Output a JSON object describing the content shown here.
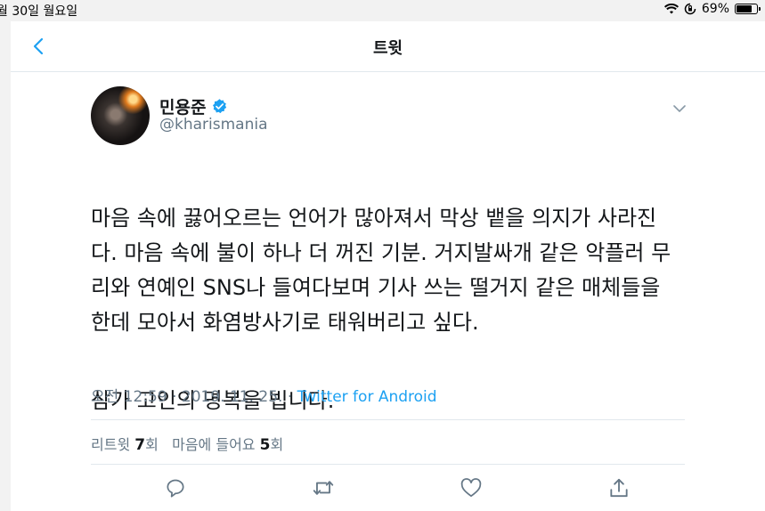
{
  "status_bar": {
    "date": "월 30일 월요일",
    "battery": "69%",
    "battery_level": 0.69
  },
  "navbar": {
    "title": "트윗",
    "back_icon": "chevron-left-icon"
  },
  "author": {
    "display_name": "민용준",
    "handle": "@kharismania",
    "verified": true
  },
  "tweet": {
    "paragraphs": [
      "마음 속에 끓어오르는 언어가 많아져서 막상 뱉을 의지가 사라진\n다. 마음 속에 불이 하나 더 꺼진 기분. 거지발싸개 같은 악플러 무\n리와 연예인 SNS나 들여다보며 기사 쓰는 떨거지 같은 매체들을\n한데 모아서 화염방사기로 태워버리고 싶다.",
      "삼가 고인의 명복을 빕니다."
    ]
  },
  "meta": {
    "time": "오전 12:59",
    "date": "2019. 11. 25.",
    "separator": "·",
    "source": "Twitter for Android"
  },
  "stats": {
    "retweets_label": "리트윗",
    "retweets_count": "7",
    "retweets_unit": "회",
    "likes_label": "마음에 들어요",
    "likes_count": "5",
    "likes_unit": "회"
  },
  "actions": [
    "reply-icon",
    "retweet-icon",
    "like-icon",
    "share-icon"
  ],
  "colors": {
    "accent": "#1da1f2",
    "secondary_text": "#657786",
    "divider": "#e1e8ed"
  }
}
